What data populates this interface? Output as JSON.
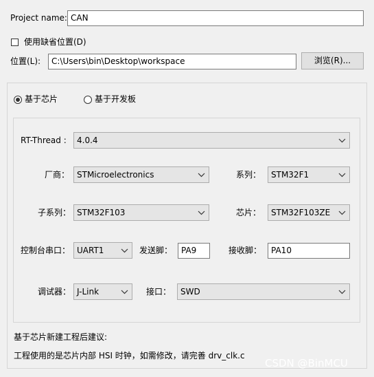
{
  "project": {
    "name_label": "Project name:",
    "name_value": "CAN"
  },
  "default_location": {
    "label": "使用缺省位置(D)",
    "checked": false
  },
  "location": {
    "label": "位置(L):",
    "value": "C:\\Users\\bin\\Desktop\\workspace",
    "browse_label": "浏览(R)..."
  },
  "mode": {
    "chip_label": "基于芯片",
    "board_label": "基于开发板",
    "selected": "chip"
  },
  "config": {
    "rtthread_label": "RT-Thread :",
    "rtthread_value": "4.0.4",
    "vendor_label": "厂商：",
    "vendor_value": "STMicroelectronics",
    "series_label": "系列：",
    "series_value": "STM32F1",
    "subseries_label": "子系列：",
    "subseries_value": "STM32F103",
    "chip_label": "芯片：",
    "chip_value": "STM32F103ZE",
    "console_label": "控制台串口：",
    "console_value": "UART1",
    "tx_label": "发送脚：",
    "tx_value": "PA9",
    "rx_label": "接收脚：",
    "rx_value": "PA10",
    "debugger_label": "调试器：",
    "debugger_value": "J-Link",
    "interface_label": "接口：",
    "interface_value": "SWD"
  },
  "advice": {
    "title": "基于芯片新建工程后建议:",
    "text": "工程使用的是芯片内部 HSI 时钟，如需修改，请完善 drv_clk.c"
  },
  "watermark": "CSDN @BinMCU",
  "icons": {
    "dropdown": "chevron-down-icon"
  }
}
